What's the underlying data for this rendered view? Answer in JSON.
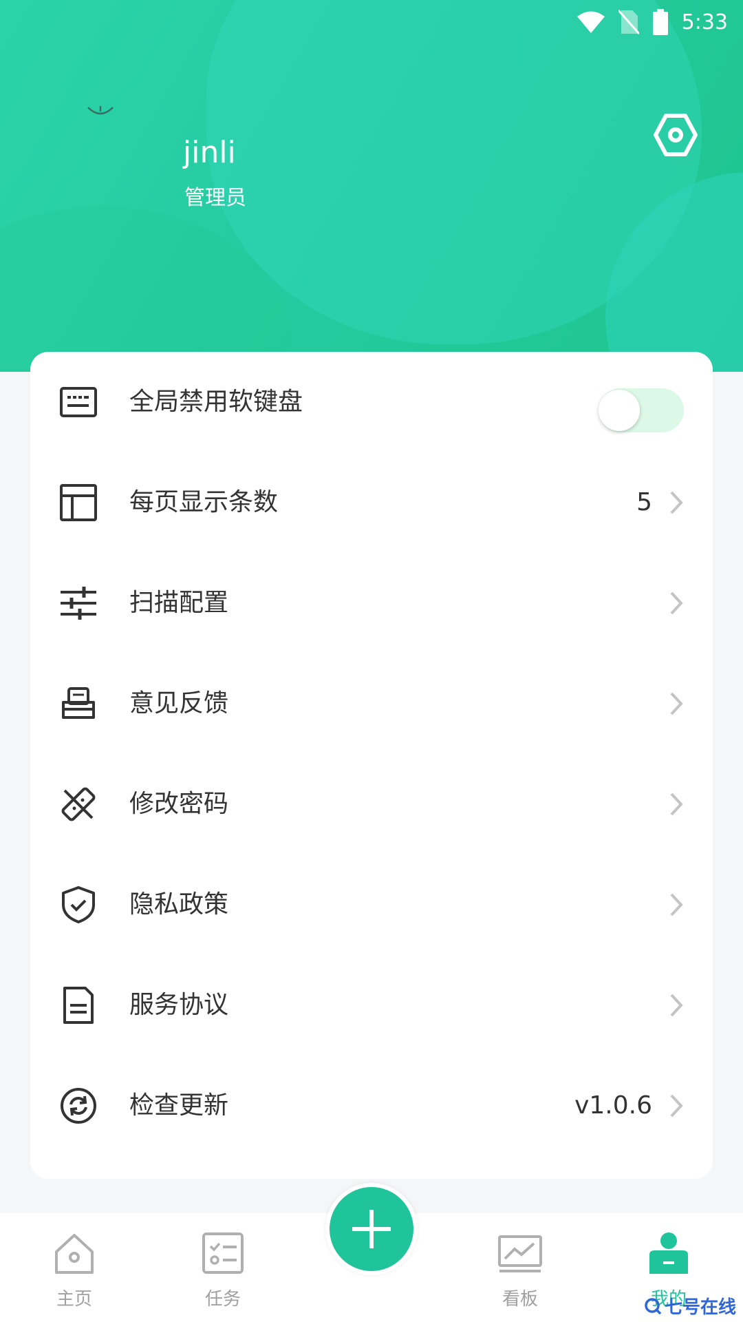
{
  "status_bar": {
    "time": "5:33",
    "icons": [
      "wifi-icon",
      "no-sim-icon",
      "battery-icon"
    ]
  },
  "profile": {
    "username": "jinli",
    "role": "管理员"
  },
  "colors": {
    "accent": "#1fc49b",
    "header_start": "#2bd4a8",
    "header_end": "#1fc48e",
    "toggle_track": "#dcf8e7",
    "text": "#333333",
    "nav_inactive": "#a0a0a0",
    "watermark": "#2f66d8"
  },
  "menu": {
    "items": [
      {
        "label": "全局禁用软键盘",
        "icon": "keyboard-icon",
        "control": "toggle",
        "toggle_on": false
      },
      {
        "label": "每页显示条数",
        "icon": "layout-icon",
        "value": "5"
      },
      {
        "label": "扫描配置",
        "icon": "sliders-icon"
      },
      {
        "label": "意见反馈",
        "icon": "feedback-icon"
      },
      {
        "label": "修改密码",
        "icon": "password-icon"
      },
      {
        "label": "隐私政策",
        "icon": "shield-check-icon"
      },
      {
        "label": "服务协议",
        "icon": "document-icon"
      },
      {
        "label": "检查更新",
        "icon": "refresh-icon",
        "value": "v1.0.6"
      }
    ]
  },
  "bottom_nav": {
    "items": [
      {
        "label": "主页",
        "icon": "home-icon"
      },
      {
        "label": "任务",
        "icon": "task-list-icon"
      },
      {
        "label": "看板",
        "icon": "chart-board-icon"
      },
      {
        "label": "我的",
        "icon": "user-icon",
        "active": true
      }
    ],
    "fab_icon": "plus-icon"
  },
  "watermark": "七号在线"
}
